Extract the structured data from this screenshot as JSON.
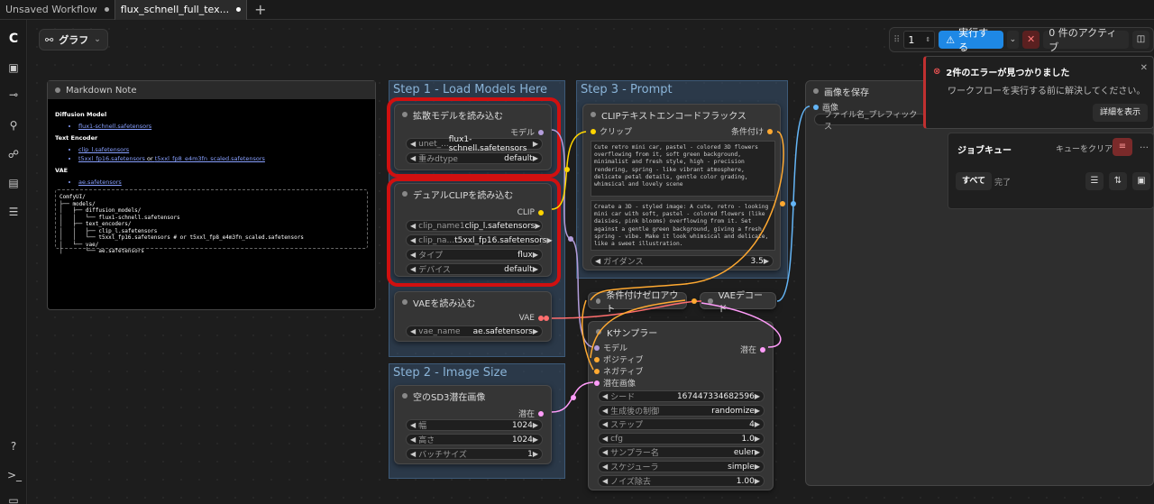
{
  "tabs": [
    {
      "label": "Unsaved Workflow",
      "active": false
    },
    {
      "label": "flux_schnell_full_tex...",
      "active": true
    }
  ],
  "graph_label": "グラフ",
  "runbar": {
    "count": "1",
    "run_label": "実行する",
    "active_label": "0 件のアクティブ"
  },
  "error": {
    "title": "2件のエラーが見つかりました",
    "message": "ワークフローを実行する前に解決してください。",
    "details_button": "詳細を表示"
  },
  "job_queue": {
    "title": "ジョブキュー",
    "clear": "キューをクリア",
    "tab_all": "すべて",
    "tab_done": "完了"
  },
  "markdown_note": {
    "title": "Markdown Note",
    "h_diffusion": "Diffusion Model",
    "diffusion_link": "flux1-schnell.safetensors",
    "h_text_encoder": "Text Encoder",
    "te_link1": "clip_l.safetensors",
    "te_link2": "t5xxl_fp16.safetensors",
    "te_or": " or ",
    "te_link3": "t5xxl_fp8_e4m3fn_scaled.safetensors",
    "h_vae": "VAE",
    "vae_link": "ae.safetensors",
    "code": "ComfyUI/\n├── models/\n│   ├── diffusion_models/\n│   │   └── flux1-schnell.safetensors\n│   ├── text_encoders/\n│   │   ├── clip_l.safetensors\n│   │   └── t5xxl_fp16.safetensors # or t5xxl_fp8_e4m3fn_scaled.safetensors\n│   └── vae/\n│       └── ae.safetensors"
  },
  "groups": {
    "step1": "Step 1 - Load Models Here",
    "step2": "Step 2 - Image Size",
    "step3": "Step 3 - Prompt"
  },
  "nodes": {
    "unet": {
      "title": "拡散モデルを読み込む",
      "out": "モデル",
      "w1_label": "unet_...",
      "w1_value": "flux1-schnell.safetensors",
      "w2_label": "重みdtype",
      "w2_value": "default"
    },
    "dualclip": {
      "title": "デュアルCLIPを読み込む",
      "out": "CLIP",
      "w1_label": "clip_name1",
      "w1_value": "clip_l.safetensors",
      "w2_label": "clip_na...",
      "w2_value": "t5xxl_fp16.safetensors",
      "w3_label": "タイプ",
      "w3_value": "flux",
      "w4_label": "デバイス",
      "w4_value": "default"
    },
    "vae": {
      "title": "VAEを読み込む",
      "out": "VAE",
      "w1_label": "vae_name",
      "w1_value": "ae.safetensors"
    },
    "latent": {
      "title": "空のSD3潜在画像",
      "out": "潜在",
      "w1_label": "幅",
      "w1_value": "1024",
      "w2_label": "高さ",
      "w2_value": "1024",
      "w3_label": "バッチサイズ",
      "w3_value": "1"
    },
    "clipenc": {
      "title": "CLIPテキストエンコードフラックス",
      "in": "クリップ",
      "out": "条件付け",
      "text1": "Cute retro mini car, pastel - colored 3D flowers overflowing from it, soft green background, minimalist and fresh style, high - precision rendering, spring - like vibrant atmosphere, delicate petal details, gentle color grading, whimsical and lovely scene",
      "text2": "Create a 3D - styled image: A cute, retro - looking mini car with soft, pastel - colored flowers (like daisies, pink blooms) overflowing from it. Set against a gentle green background, giving a fresh, spring - vibe. Make it look whimsical and delicate, like a sweet illustration.",
      "w_label": "ガイダンス",
      "w_value": "3.5"
    },
    "zeroout": {
      "title": "条件付けゼロアウト"
    },
    "vaedecode": {
      "title": "VAEデコード"
    },
    "ksampler": {
      "title": "Kサンプラー",
      "in1": "モデル",
      "in2": "ポジティブ",
      "in3": "ネガティブ",
      "in4": "潜在画像",
      "out": "潜在",
      "w1_label": "シード",
      "w1_value": "167447334682596",
      "w2_label": "生成後の制御",
      "w2_value": "randomize",
      "w3_label": "ステップ",
      "w3_value": "4",
      "w4_label": "cfg",
      "w4_value": "1.0",
      "w5_label": "サンプラー名",
      "w5_value": "euler",
      "w6_label": "スケジューラ",
      "w6_value": "simple",
      "w7_label": "ノイズ除去",
      "w7_value": "1.00"
    },
    "save": {
      "title": "画像を保存",
      "in": "画像",
      "w_label": "ファイル名_プレフィックス"
    }
  },
  "colors": {
    "model": "#b39ddb",
    "clip": "#ffd500",
    "vae": "#ff6e6e",
    "latent": "#ff9cf9",
    "cond": "#ffa931",
    "image": "#64b5f6",
    "run": "#1e88e5",
    "error": "#c03030"
  }
}
